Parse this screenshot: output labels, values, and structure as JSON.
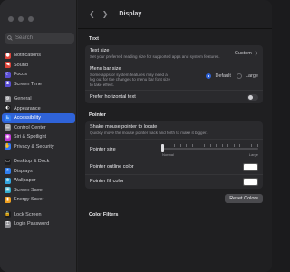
{
  "window": {
    "title": "Display"
  },
  "search": {
    "placeholder": "Search"
  },
  "sidebar": {
    "items": [
      {
        "label": "Notifications",
        "icon": "bell-icon",
        "color": "#e0443a",
        "glyph": "●"
      },
      {
        "label": "Sound",
        "icon": "speaker-icon",
        "color": "#e0443a",
        "glyph": "◀"
      },
      {
        "label": "Focus",
        "icon": "moon-icon",
        "color": "#5b4fd6",
        "glyph": "☾"
      },
      {
        "label": "Screen Time",
        "icon": "hourglass-icon",
        "color": "#5b4fd6",
        "glyph": "⧗"
      },
      {
        "label": "General",
        "icon": "gear-icon",
        "color": "#8e8e93",
        "glyph": "⚙",
        "gap": true
      },
      {
        "label": "Appearance",
        "icon": "appearance-icon",
        "color": "#1c1c1e",
        "glyph": "◐"
      },
      {
        "label": "Accessibility",
        "icon": "accessibility-icon",
        "color": "#2f7ff0",
        "glyph": "♿",
        "active": true
      },
      {
        "label": "Control Center",
        "icon": "control-center-icon",
        "color": "#8e8e93",
        "glyph": "▤"
      },
      {
        "label": "Siri & Spotlight",
        "icon": "siri-icon",
        "color": "#c03ad8",
        "glyph": "◉"
      },
      {
        "label": "Privacy & Security",
        "icon": "hand-icon",
        "color": "#3478f6",
        "glyph": "✋"
      },
      {
        "label": "Desktop & Dock",
        "icon": "dock-icon",
        "color": "#1c1c1e",
        "glyph": "▭",
        "gap": true
      },
      {
        "label": "Displays",
        "icon": "display-icon",
        "color": "#2f7ff0",
        "glyph": "☀"
      },
      {
        "label": "Wallpaper",
        "icon": "wallpaper-icon",
        "color": "#33a6e0",
        "glyph": "❋"
      },
      {
        "label": "Screen Saver",
        "icon": "screen-saver-icon",
        "color": "#33b0d0",
        "glyph": "▣"
      },
      {
        "label": "Energy Saver",
        "icon": "battery-icon",
        "color": "#f0a020",
        "glyph": "▮"
      },
      {
        "label": "Lock Screen",
        "icon": "lock-icon",
        "color": "#1c1c1e",
        "glyph": "🔒",
        "gap": true
      },
      {
        "label": "Login Password",
        "icon": "key-icon",
        "color": "#8e8e93",
        "glyph": "⚿"
      }
    ]
  },
  "sections": {
    "text": {
      "header": "Text",
      "text_size": {
        "label": "Text size",
        "desc": "Set your preferred reading size for supported apps and system features.",
        "value": "Custom"
      },
      "menu_bar_size": {
        "label": "Menu bar size",
        "desc": "Some apps or system features may need a log out for the changes to menu bar font size to take effect.",
        "option1": "Default",
        "option2": "Large"
      },
      "horizontal_text": {
        "label": "Prefer horizontal text"
      }
    },
    "pointer": {
      "header": "Pointer",
      "shake": {
        "label": "Shake mouse pointer to locate",
        "desc": "Quickly move the mouse pointer back and forth to make it bigger."
      },
      "size": {
        "label": "Pointer size",
        "min_label": "Normal",
        "max_label": "Large",
        "value_fraction": 0
      },
      "outline": {
        "label": "Pointer outline color",
        "color": "#ffffff"
      },
      "fill": {
        "label": "Pointer fill color",
        "color": "#ffffff"
      },
      "reset_label": "Reset Colors"
    },
    "color_filters": {
      "header": "Color Filters"
    }
  }
}
